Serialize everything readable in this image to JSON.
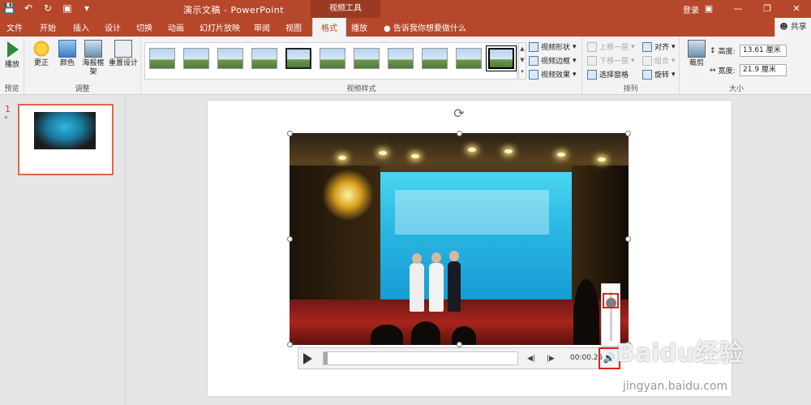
{
  "titlebar": {
    "doc_title": "演示文稿 - PowerPoint",
    "context_tool": "视频工具",
    "login": "登录"
  },
  "tabs": [
    "文件",
    "开始",
    "插入",
    "设计",
    "切换",
    "动画",
    "幻灯片放映",
    "审阅",
    "视图",
    "格式",
    "播放"
  ],
  "active_tab": "格式",
  "tell_me": "告诉我你想要做什么",
  "share": "共享",
  "ribbon": {
    "preview": {
      "btn": "播放",
      "label": "预览"
    },
    "adjust": {
      "btns": [
        "更正",
        "颜色",
        "海报框架",
        "重置设计"
      ],
      "label": "调整"
    },
    "video_styles": {
      "label": "视频样式",
      "options": [
        "视频形状",
        "视频边框",
        "视频效果"
      ]
    },
    "arrange": {
      "label": "排列",
      "items": [
        "上移一层",
        "下移一层",
        "选择窗格",
        "对齐",
        "组合",
        "旋转"
      ]
    },
    "size": {
      "crop": "裁剪",
      "label": "大小",
      "height_label": "高度:",
      "height_value": "13.61 厘米",
      "width_label": "宽度:",
      "width_value": "21.9 厘米"
    }
  },
  "slides": {
    "number": "1",
    "star": "*"
  },
  "player": {
    "time": "00:00.25",
    "volume_level": 0.85
  },
  "watermark": {
    "brand": "Baidu经验",
    "url": "jingyan.baidu.com"
  },
  "colors": {
    "accent": "#b7472a",
    "highlight": "#e0201a"
  }
}
